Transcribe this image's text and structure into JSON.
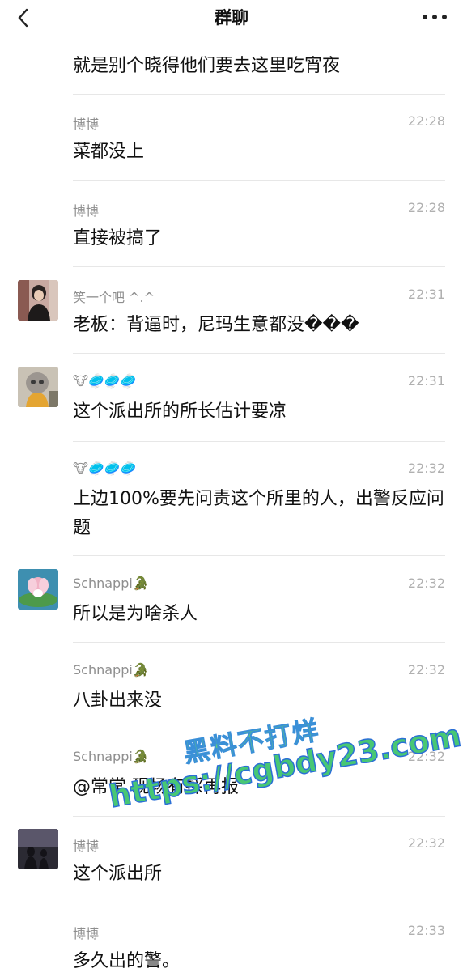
{
  "header": {
    "title": "群聊"
  },
  "first_message": "就是别个晓得他们要去这里吃宵夜",
  "messages": [
    {
      "name": "博博",
      "time": "22:28",
      "text": "菜都没上"
    },
    {
      "name": "博博",
      "time": "22:28",
      "text": "直接被搞了"
    },
    {
      "name": "笑一个吧 ^.^",
      "time": "22:31",
      "text": "老板：背逼时，尼玛生意都没���"
    },
    {
      "name": "🐮🥏🥏🥏",
      "time": "22:31",
      "text": "这个派出所的所长估计要凉"
    },
    {
      "name": "🐮🥏🥏🥏",
      "time": "22:32",
      "text": "上边100%要先问责这个所里的人，出警反应问题"
    },
    {
      "name": "Schnappi🐊",
      "time": "22:32",
      "text": "所以是为啥杀人"
    },
    {
      "name": "Schnappi🐊",
      "time": "22:32",
      "text": "八卦出来没"
    },
    {
      "name": "Schnappi🐊",
      "time": "22:32",
      "text": "@常常 现场有採再报"
    },
    {
      "name": "博博",
      "time": "22:32",
      "text": "这个派出所"
    },
    {
      "name": "博博",
      "time": "22:33",
      "text": "多久出的警。"
    }
  ],
  "watermark": {
    "line1": "黑料不打烊",
    "line2": "https://cgbdy23.com"
  },
  "colors": {
    "name": "#8e8e8e",
    "time": "#b0b0b0",
    "divider": "#e7e7e7"
  }
}
